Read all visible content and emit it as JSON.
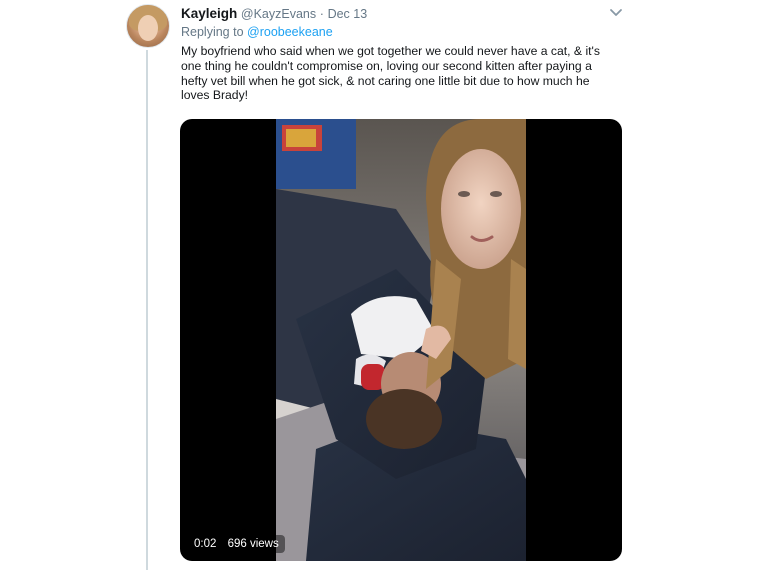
{
  "tweet": {
    "display_name": "Kayleigh",
    "handle": "@KayzEvans",
    "separator": "·",
    "date": "Dec 13",
    "replying_prefix": "Replying to ",
    "replying_to": "@roobeekeane",
    "text": "My boyfriend who said when we got together we could never have a cat, & it's one thing he couldn't compromise on, loving our second kitten after paying a hefty vet bill when he got sick, & not caring one little bit due to how much he loves Brady!"
  },
  "video": {
    "duration": "0:02",
    "views": "696 views"
  },
  "icons": {
    "more": "chevron-down-icon",
    "avatar": "avatar"
  },
  "colors": {
    "link": "#1da1f2",
    "text": "#14171a",
    "secondary": "#657786",
    "thread_line": "#cfd9de"
  }
}
